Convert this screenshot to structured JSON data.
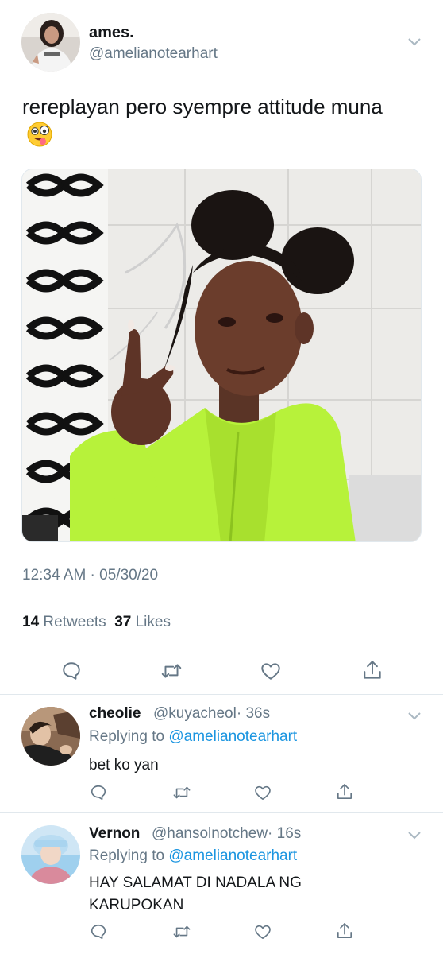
{
  "tweet": {
    "display_name": "ames.",
    "handle": "@amelianotearhart",
    "text": "rereplayan pero syempre attitude muna",
    "emoji": "zany-face",
    "timestamp": "12:34 AM · 05/30/20",
    "retweets_count": "14",
    "retweets_label": "Retweets",
    "likes_count": "37",
    "likes_label": "Likes"
  },
  "replies": [
    {
      "display_name": "cheolie",
      "handle": "@kuyacheol",
      "time": "· 36s",
      "replying_prefix": "Replying to",
      "replying_to": "@amelianotearhart",
      "text": "bet ko yan"
    },
    {
      "display_name": "Vernon",
      "handle": "@hansolnotchew",
      "time": "· 16s",
      "replying_prefix": "Replying to",
      "replying_to": "@amelianotearhart",
      "text": "HAY SALAMAT DI NADALA NG KARUPOKAN"
    }
  ],
  "icons": [
    "reply-icon",
    "retweet-icon",
    "like-icon",
    "share-icon",
    "chevron-down-icon"
  ],
  "colors": {
    "text": "#14171a",
    "muted": "#657786",
    "link": "#1b95e0",
    "divider": "#e1e8ed",
    "hoodie": "#b7f23a"
  }
}
